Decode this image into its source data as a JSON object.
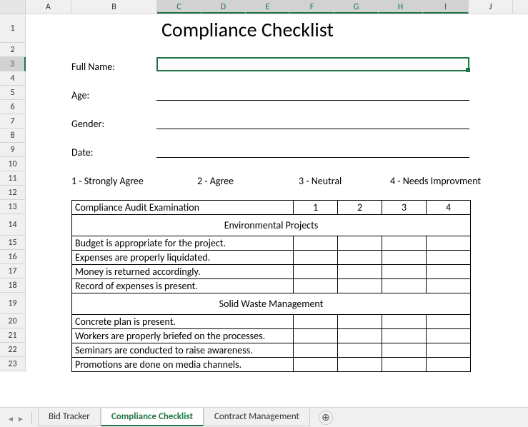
{
  "columns": [
    "A",
    "B",
    "C",
    "D",
    "E",
    "F",
    "G",
    "H",
    "I",
    "J"
  ],
  "selected_cols": [
    "C",
    "D",
    "E",
    "F",
    "G",
    "H",
    "I"
  ],
  "rows": [
    "1",
    "2",
    "3",
    "4",
    "5",
    "6",
    "7",
    "8",
    "9",
    "10",
    "11",
    "12",
    "13",
    "14",
    "15",
    "16",
    "17",
    "18",
    "19",
    "20",
    "21",
    "22",
    "23"
  ],
  "selected_row": "3",
  "title": "Compliance Checklist",
  "labels": {
    "name": "Full Name:",
    "age": "Age:",
    "gender": "Gender:",
    "date": "Date:"
  },
  "scale": {
    "s1": "1 - Strongly Agree",
    "s2": "2 - Agree",
    "s3": "3 - Neutral",
    "s4": "4 - Needs Improvment"
  },
  "table": {
    "header": "Compliance Audit Examination",
    "cols": [
      "1",
      "2",
      "3",
      "4"
    ],
    "section1": {
      "title": "Environmental Projects",
      "rows": [
        "Budget is appropriate for the project.",
        "Expenses are properly liquidated.",
        "Money is returned accordingly.",
        "Record of expenses is present."
      ]
    },
    "section2": {
      "title": "Solid Waste Management",
      "rows": [
        "Concrete plan is present.",
        "Workers are properly briefed on the processes.",
        "Seminars are conducted to raise awareness.",
        "Promotions are done on media channels."
      ]
    }
  },
  "tabs": {
    "t1": "Bid Tracker",
    "t2": "Compliance Checklist",
    "t3": "Contract Management"
  }
}
